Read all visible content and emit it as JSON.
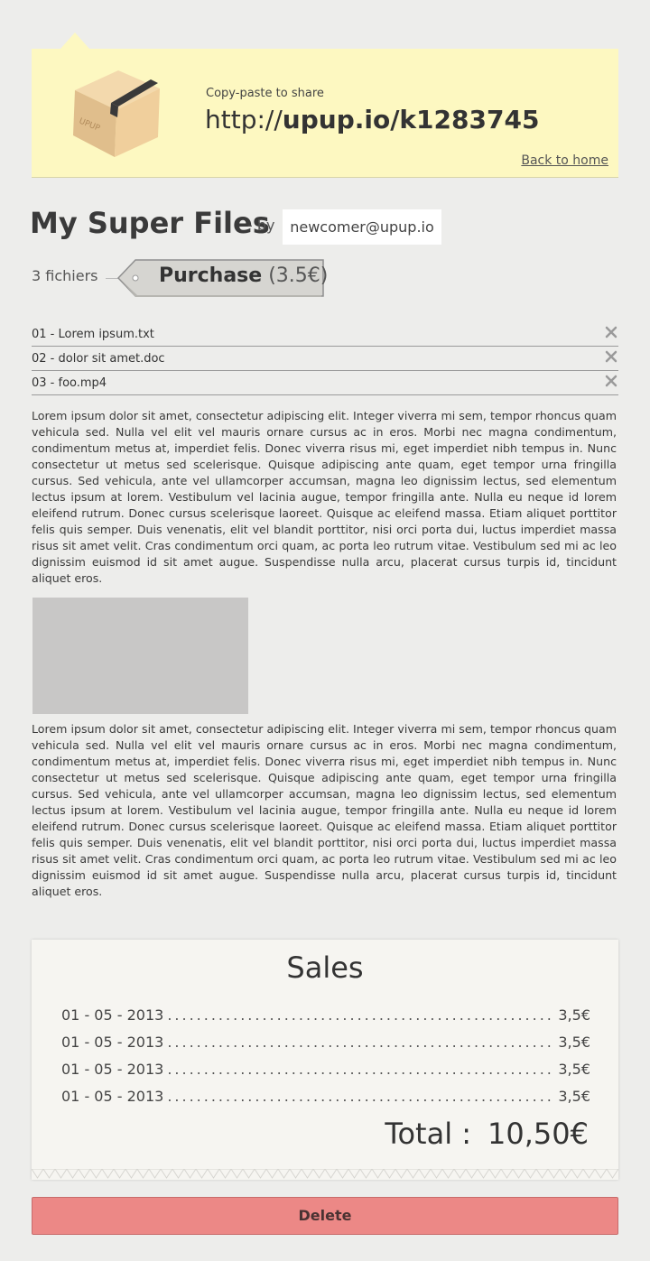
{
  "share": {
    "label": "Copy-paste to share",
    "url_prefix": "http://",
    "url_main": "upup.io/k1283745",
    "back_home": "Back to home",
    "box_icon": "package-box-icon",
    "box_text": "UPUP"
  },
  "header": {
    "title": "My Super Files",
    "by": "- by",
    "author": "newcomer@upup.io"
  },
  "files_summary": {
    "count": "3 fichiers",
    "purchase_label": "Purchase",
    "purchase_price": "(3.5€)"
  },
  "files": [
    {
      "name": "01 - Lorem ipsum.txt"
    },
    {
      "name": "02 - dolor sit amet.doc"
    },
    {
      "name": "03 - foo.mp4"
    }
  ],
  "description": {
    "paragraph_1": "Lorem ipsum dolor sit amet, consectetur adipiscing elit. Integer viverra mi sem, tempor rhoncus quam vehicula sed. Nulla vel elit vel mauris ornare cursus ac in eros. Morbi nec magna condimentum, condimentum metus at, imperdiet felis. Donec viverra risus mi, eget imperdiet nibh tempus in. Nunc consectetur ut metus sed scelerisque. Quisque adipiscing ante quam, eget tempor urna fringilla cursus. Sed vehicula, ante vel ullamcorper accumsan, magna leo dignissim lectus, sed elementum lectus ipsum at lorem. Vestibulum vel lacinia augue, tempor fringilla ante. Nulla eu neque id lorem eleifend rutrum. Donec cursus scelerisque laoreet. Quisque ac eleifend massa. Etiam aliquet porttitor felis quis semper. Duis venenatis, elit vel blandit porttitor, nisi orci porta dui, luctus imperdiet massa risus sit amet velit. Cras condimentum orci quam, ac porta leo rutrum vitae. Vestibulum sed mi ac leo dignissim euismod id sit amet augue. Suspendisse nulla arcu, placerat cursus turpis id, tincidunt aliquet eros.",
    "paragraph_2": "Lorem ipsum dolor sit amet, consectetur adipiscing elit. Integer viverra mi sem, tempor rhoncus quam vehicula sed. Nulla vel elit vel mauris ornare cursus ac in eros. Morbi nec magna condimentum, condimentum metus at, imperdiet felis. Donec viverra risus mi, eget imperdiet nibh tempus in. Nunc consectetur ut metus sed scelerisque. Quisque adipiscing ante quam, eget tempor urna fringilla cursus. Sed vehicula, ante vel ullamcorper accumsan, magna leo dignissim lectus, sed elementum lectus ipsum at lorem. Vestibulum vel lacinia augue, tempor fringilla ante. Nulla eu neque id lorem eleifend rutrum. Donec cursus scelerisque laoreet. Quisque ac eleifend massa. Etiam aliquet porttitor felis quis semper. Duis venenatis, elit vel blandit porttitor, nisi orci porta dui, luctus imperdiet massa risus sit amet velit. Cras condimentum orci quam, ac porta leo rutrum vitae. Vestibulum sed mi ac leo dignissim euismod id sit amet augue. Suspendisse nulla arcu, placerat cursus turpis id, tincidunt aliquet eros."
  },
  "sales": {
    "title": "Sales",
    "rows": [
      {
        "date": "01 - 05 - 2013",
        "amount": "3,5€"
      },
      {
        "date": "01 - 05 - 2013",
        "amount": "3,5€"
      },
      {
        "date": "01 - 05 - 2013",
        "amount": "3,5€"
      },
      {
        "date": "01 - 05 - 2013",
        "amount": "3,5€"
      }
    ],
    "total_label": "Total :",
    "total_value": "10,50€"
  },
  "actions": {
    "delete_label": "Delete"
  },
  "colors": {
    "banner": "#fdf8c1",
    "background": "#ededeb",
    "delete": "#ec8886",
    "tag": "#d6d5d1"
  }
}
